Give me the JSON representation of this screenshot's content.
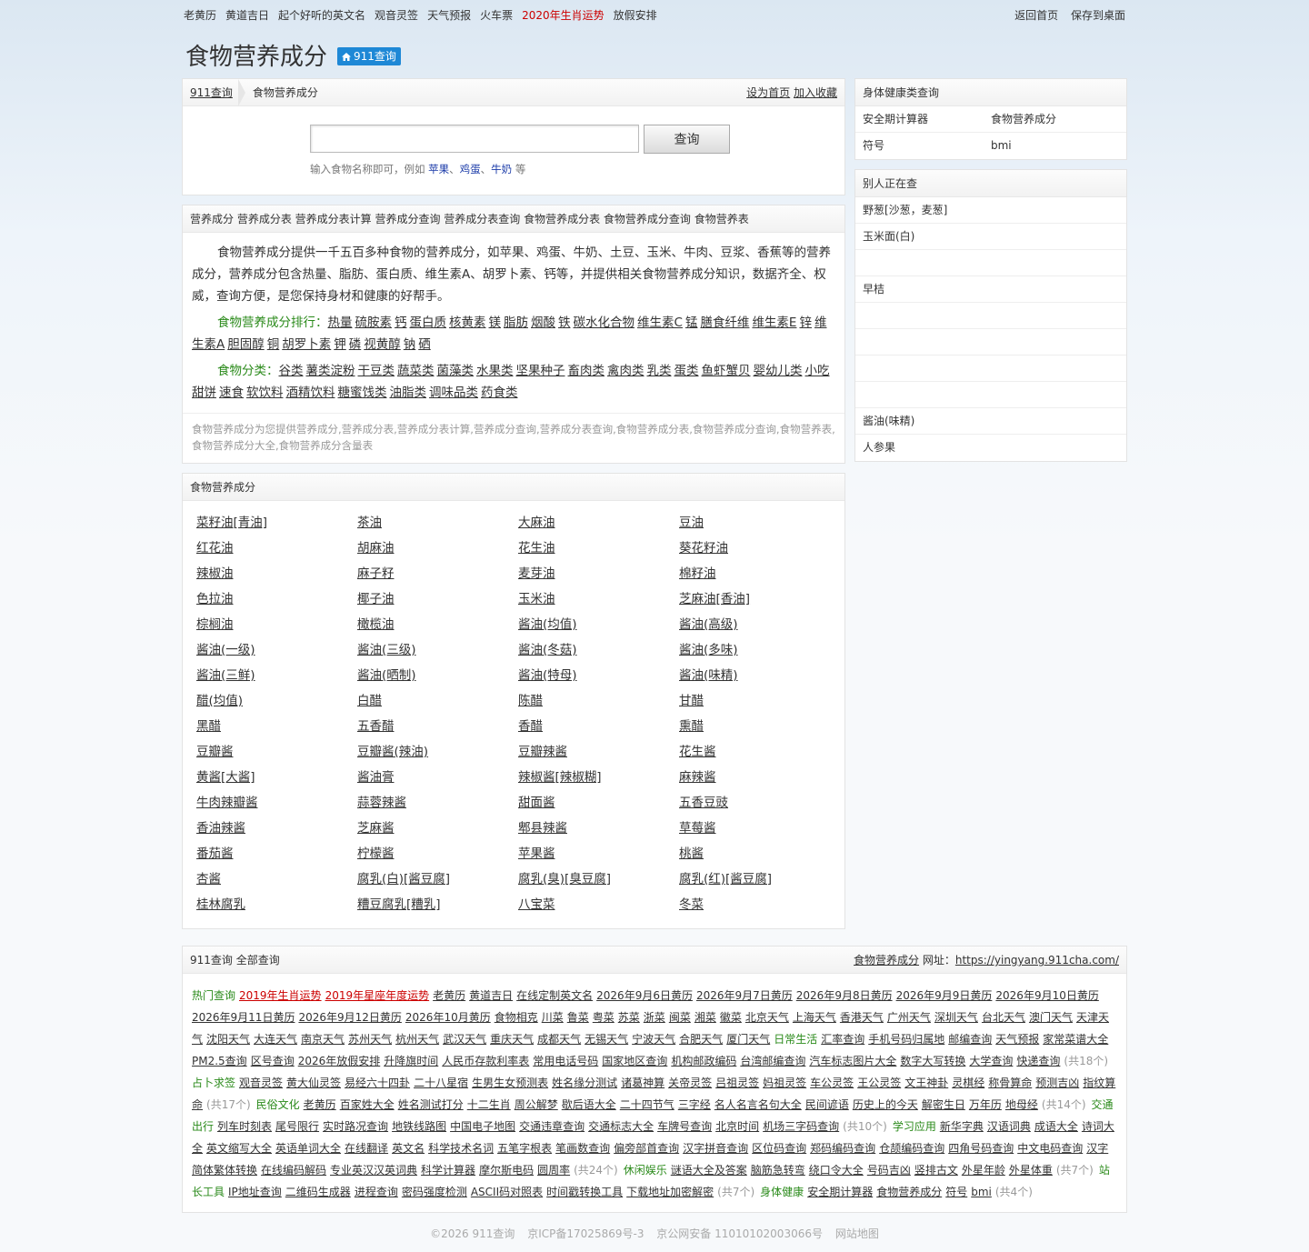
{
  "topnav": {
    "links": [
      {
        "label": "老黄历",
        "red": false
      },
      {
        "label": "黄道吉日",
        "red": false
      },
      {
        "label": "起个好听的英文名",
        "red": false
      },
      {
        "label": "观音灵签",
        "red": false
      },
      {
        "label": "天气预报",
        "red": false
      },
      {
        "label": "火车票",
        "red": false
      },
      {
        "label": "2020年生肖运势",
        "red": true
      },
      {
        "label": "放假安排",
        "red": false
      }
    ],
    "right": [
      "返回首页",
      "保存到桌面"
    ]
  },
  "header": {
    "title": "食物营养成分",
    "badge": "911查询"
  },
  "breadcrumb": {
    "home": "911查询",
    "current": "食物营养成分",
    "set_home": "设为首页",
    "bookmark": "加入收藏"
  },
  "search": {
    "value": "",
    "button": "查询",
    "hint_prefix": "输入食物名称即可，例如",
    "examples": [
      "苹果",
      "鸡蛋",
      "牛奶"
    ],
    "hint_suffix": "等"
  },
  "tags_header": "营养成分 营养成分表 营养成分表计算 营养成分查询 营养成分表查询 食物营养成分表 食物营养成分查询 食物营养表",
  "intro": {
    "text": "食物营养成分提供一千五百多种食物的营养成分，如苹果、鸡蛋、牛奶、土豆、玉米、牛肉、豆浆、香蕉等的营养成分，营养成分包含热量、脂肪、蛋白质、维生素A、胡罗卜素、钙等，并提供相关食物营养成分知识，数据齐全、权威，查询方便，是您保持身材和健康的好帮手。",
    "ranking_label": "食物营养成分排行：",
    "ranking": [
      "热量",
      "硫胺素",
      "钙",
      "蛋白质",
      "核黄素",
      "镁",
      "脂肪",
      "烟酸",
      "铁",
      "碳水化合物",
      "维生素C",
      "锰",
      "膳食纤维",
      "维生素E",
      "锌",
      "维生素A",
      "胆固醇",
      "铜",
      "胡罗卜素",
      "钾",
      "磷",
      "视黄醇",
      "钠",
      "硒"
    ],
    "category_label": "食物分类：",
    "categories": [
      "谷类",
      "薯类淀粉",
      "干豆类",
      "蔬菜类",
      "菌藻类",
      "水果类",
      "坚果种子",
      "畜肉类",
      "禽肉类",
      "乳类",
      "蛋类",
      "鱼虾蟹贝",
      "婴幼儿类",
      "小吃甜饼",
      "速食",
      "软饮料",
      "酒精饮料",
      "糖蜜饯类",
      "油脂类",
      "调味品类",
      "药食类"
    ],
    "description": "食物营养成分为您提供营养成分,营养成分表,营养成分表计算,营养成分查询,营养成分表查询,食物营养成分表,食物营养成分查询,食物营养表,食物营养成分大全,食物营养成分含量表"
  },
  "food_list": {
    "title": "食物营养成分",
    "items": [
      "菜籽油[青油]",
      "茶油",
      "大麻油",
      "豆油",
      "红花油",
      "胡麻油",
      "花生油",
      "葵花籽油",
      "辣椒油",
      "麻子籽",
      "麦芽油",
      "棉籽油",
      "色拉油",
      "椰子油",
      "玉米油",
      "芝麻油[香油]",
      "棕榈油",
      "橄榄油",
      "酱油(均值)",
      "酱油(高级)",
      "酱油(一级)",
      "酱油(三级)",
      "酱油(冬菇)",
      "酱油(多味)",
      "酱油(三鲜)",
      "酱油(晒制)",
      "酱油(特母)",
      "酱油(味精)",
      "醋(均值)",
      "白醋",
      "陈醋",
      "甘醋",
      "黑醋",
      "五香醋",
      "香醋",
      "熏醋",
      "豆瓣酱",
      "豆瓣酱(辣油)",
      "豆瓣辣酱",
      "花生酱",
      "黄酱[大酱]",
      "酱油膏",
      "辣椒酱[辣椒糊]",
      "麻辣酱",
      "牛肉辣瓣酱",
      "蒜蓉辣酱",
      "甜面酱",
      "五香豆豉",
      "香油辣酱",
      "芝麻酱",
      "郫县辣酱",
      "草莓酱",
      "番茄酱",
      "柠檬酱",
      "苹果酱",
      "桃酱",
      "杏酱",
      "腐乳(白)[酱豆腐]",
      "腐乳(臭)[臭豆腐]",
      "腐乳(红)[酱豆腐]",
      "桂林腐乳",
      "糟豆腐乳[糟乳]",
      "八宝菜",
      "冬菜"
    ]
  },
  "side_health": {
    "title": "身体健康类查询",
    "rows": [
      [
        "安全期计算器",
        "食物营养成分"
      ],
      [
        "符号",
        "bmi"
      ]
    ]
  },
  "side_recent": {
    "title": "别人正在查",
    "rows": [
      "野葱[沙葱，麦葱]",
      "玉米面(白)",
      "",
      "早桔",
      "",
      "",
      "",
      "",
      "酱油(味精)",
      "人参果"
    ]
  },
  "all_queries": {
    "title": "911查询 全部查询",
    "site_label": "食物营养成分",
    "url_label": "网址：",
    "url": "https://yingyang.911cha.com/",
    "groups": [
      {
        "cat": "热门查询",
        "links": [
          "2019年生肖运势|red",
          "2019年星座年度运势|red",
          "老黄历",
          "黄道吉日",
          "在线定制英文名",
          "2026年9月6日黄历",
          "2026年9月7日黄历",
          "2026年9月8日黄历",
          "2026年9月9日黄历",
          "2026年9月10日黄历",
          "2026年9月11日黄历",
          "2026年9月12日黄历",
          "2026年10月黄历",
          "食物相克",
          "川菜",
          "鲁菜",
          "粤菜",
          "苏菜",
          "浙菜",
          "闽菜",
          "湘菜",
          "徽菜",
          "北京天气",
          "上海天气",
          "香港天气",
          "广州天气",
          "深圳天气",
          "台北天气",
          "澳门天气",
          "天津天气",
          "沈阳天气",
          "大连天气",
          "南京天气",
          "苏州天气",
          "杭州天气",
          "武汉天气",
          "重庆天气",
          "成都天气",
          "无锡天气",
          "宁波天气",
          "合肥天气",
          "厦门天气"
        ],
        "count": ""
      },
      {
        "cat": "日常生活",
        "links": [
          "汇率查询",
          "手机号码归属地",
          "邮编查询",
          "天气预报",
          "家常菜谱大全",
          "PM2.5查询",
          "区号查询",
          "2026年放假安排",
          "升降旗时间",
          "人民币存款利率表",
          "常用电话号码",
          "国家地区查询",
          "机构邮政编码",
          "台湾邮编查询",
          "汽车标志图片大全",
          "数字大写转换",
          "大学查询",
          "快递查询"
        ],
        "count": "(共18个)"
      },
      {
        "cat": "占卜求签",
        "links": [
          "观音灵签",
          "黄大仙灵签",
          "易经六十四卦",
          "二十八星宿",
          "生男生女预测表",
          "姓名缘分测试",
          "诸葛神算",
          "关帝灵签",
          "吕祖灵签",
          "妈祖灵签",
          "车公灵签",
          "王公灵签",
          "文王神卦",
          "灵棋经",
          "称骨算命",
          "预测吉凶",
          "指纹算命"
        ],
        "count": "(共17个)"
      },
      {
        "cat": "民俗文化",
        "links": [
          "老黄历",
          "百家姓大全",
          "姓名测试打分",
          "十二生肖",
          "周公解梦",
          "歇后语大全",
          "二十四节气",
          "三字经",
          "名人名言名句大全",
          "民间谚语",
          "历史上的今天",
          "解密生日",
          "万年历",
          "地母经"
        ],
        "count": "(共14个)"
      },
      {
        "cat": "交通出行",
        "links": [
          "列车时刻表",
          "尾号限行",
          "实时路况查询",
          "地铁线路图",
          "中国电子地图",
          "交通违章查询",
          "交通标志大全",
          "车牌号查询",
          "北京时间",
          "机场三字码查询"
        ],
        "count": "(共10个)"
      },
      {
        "cat": "学习应用",
        "links": [
          "新华字典",
          "汉语词典",
          "成语大全",
          "诗词大全",
          "英文缩写大全",
          "英语单词大全",
          "在线翻译",
          "英文名",
          "科学技术名词",
          "五笔字根表",
          "笔画数查询",
          "偏旁部首查询",
          "汉字拼音查询",
          "区位码查询",
          "郑码编码查询",
          "仓颉编码查询",
          "四角号码查询",
          "中文电码查询",
          "汉字简体繁体转换",
          "在线编码解码",
          "专业英汉汉英词典",
          "科学计算器",
          "摩尔斯电码",
          "圆周率"
        ],
        "count": "(共24个)"
      },
      {
        "cat": "休闲娱乐",
        "links": [
          "谜语大全及答案",
          "脑筋急转弯",
          "绕口令大全",
          "号码吉凶",
          "竖排古文",
          "外星年龄",
          "外星体重"
        ],
        "count": "(共7个)"
      },
      {
        "cat": "站长工具",
        "links": [
          "IP地址查询",
          "二维码生成器",
          "进程查询",
          "密码强度检测",
          "ASCII码对照表",
          "时间戳转换工具",
          "下载地址加密解密"
        ],
        "count": "(共7个)"
      },
      {
        "cat": "身体健康",
        "links": [
          "安全期计算器",
          "食物营养成分",
          "符号",
          "bmi"
        ],
        "count": "(共4个)"
      }
    ]
  },
  "footer": {
    "copyright": "©2026 911查询",
    "icp": "京ICP备17025869号-3",
    "police": "京公网安备 11010102003066号",
    "sitemap": "网站地图"
  },
  "colors": {
    "accent": "#1e88d6",
    "red": "#cc0000",
    "green": "#2a8a1a"
  }
}
